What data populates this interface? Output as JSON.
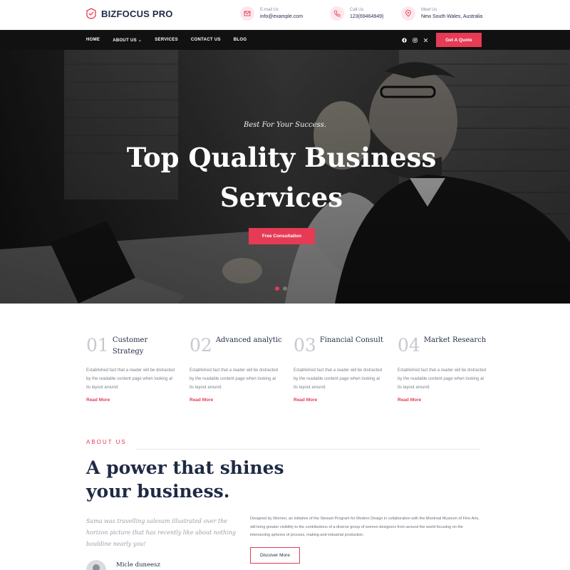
{
  "brand": {
    "name": "BIZFOCUS PRO",
    "logo_icon": "handshake-badge-icon"
  },
  "contacts": [
    {
      "icon": "email-icon",
      "label": "E-mail Us",
      "value": "info@example.com"
    },
    {
      "icon": "phone-icon",
      "label": "Call Us",
      "value": "123(69464949)"
    },
    {
      "icon": "location-icon",
      "label": "Meet Us",
      "value": "New South Wales, Australia"
    }
  ],
  "nav": {
    "items": [
      "HOME",
      "ABOUT US ⌄",
      "SERVICES",
      "CONTACT US",
      "BLOG"
    ],
    "social": [
      "facebook-icon",
      "instagram-icon",
      "x-icon"
    ],
    "cta": "Get A Quote"
  },
  "hero": {
    "tagline": "Best For Your Success.",
    "title": "Top Quality Business Services",
    "button": "Free Consultation",
    "slides": 2,
    "active_slide": 1
  },
  "features": [
    {
      "num": "01",
      "title": "Customer Strategy",
      "text": "Established fact that a reader will be distracted by the readable content page when looking at its layout around.",
      "link": "Read More"
    },
    {
      "num": "02",
      "title": "Advanced analytic",
      "text": "Established fact that a reader will be distracted by the readable content page when looking at its layout around.",
      "link": "Read More"
    },
    {
      "num": "03",
      "title": "Financial Consult",
      "text": "Established fact that a reader will be distracted by the readable content page when looking at its layout around.",
      "link": "Read More"
    },
    {
      "num": "04",
      "title": "Market Research",
      "text": "Established fact that a reader will be distracted by the readable content page when looking at its layout around.",
      "link": "Read More"
    }
  ],
  "about": {
    "eyebrow": "ABOUT US",
    "title": "A power that shines your business.",
    "quote": "Sama was travelling salesam illustrated over the horizon picture that has recently like about nothing bouldine nearly you!",
    "description": "Designed by Women, an initiative of the Stewart Program for Modern Design in collaboration with the Montreal Museum of Fine Arts, will bring greater visibility to the contributions of a diverse group of women designers from around the world focusing on the intersecting spheres of process, making and industrial production.",
    "button": "Discover More",
    "author": "Micle duneesz"
  },
  "colors": {
    "accent": "#e63b55",
    "navy": "#1f2a44",
    "nav_bg": "#111111"
  }
}
